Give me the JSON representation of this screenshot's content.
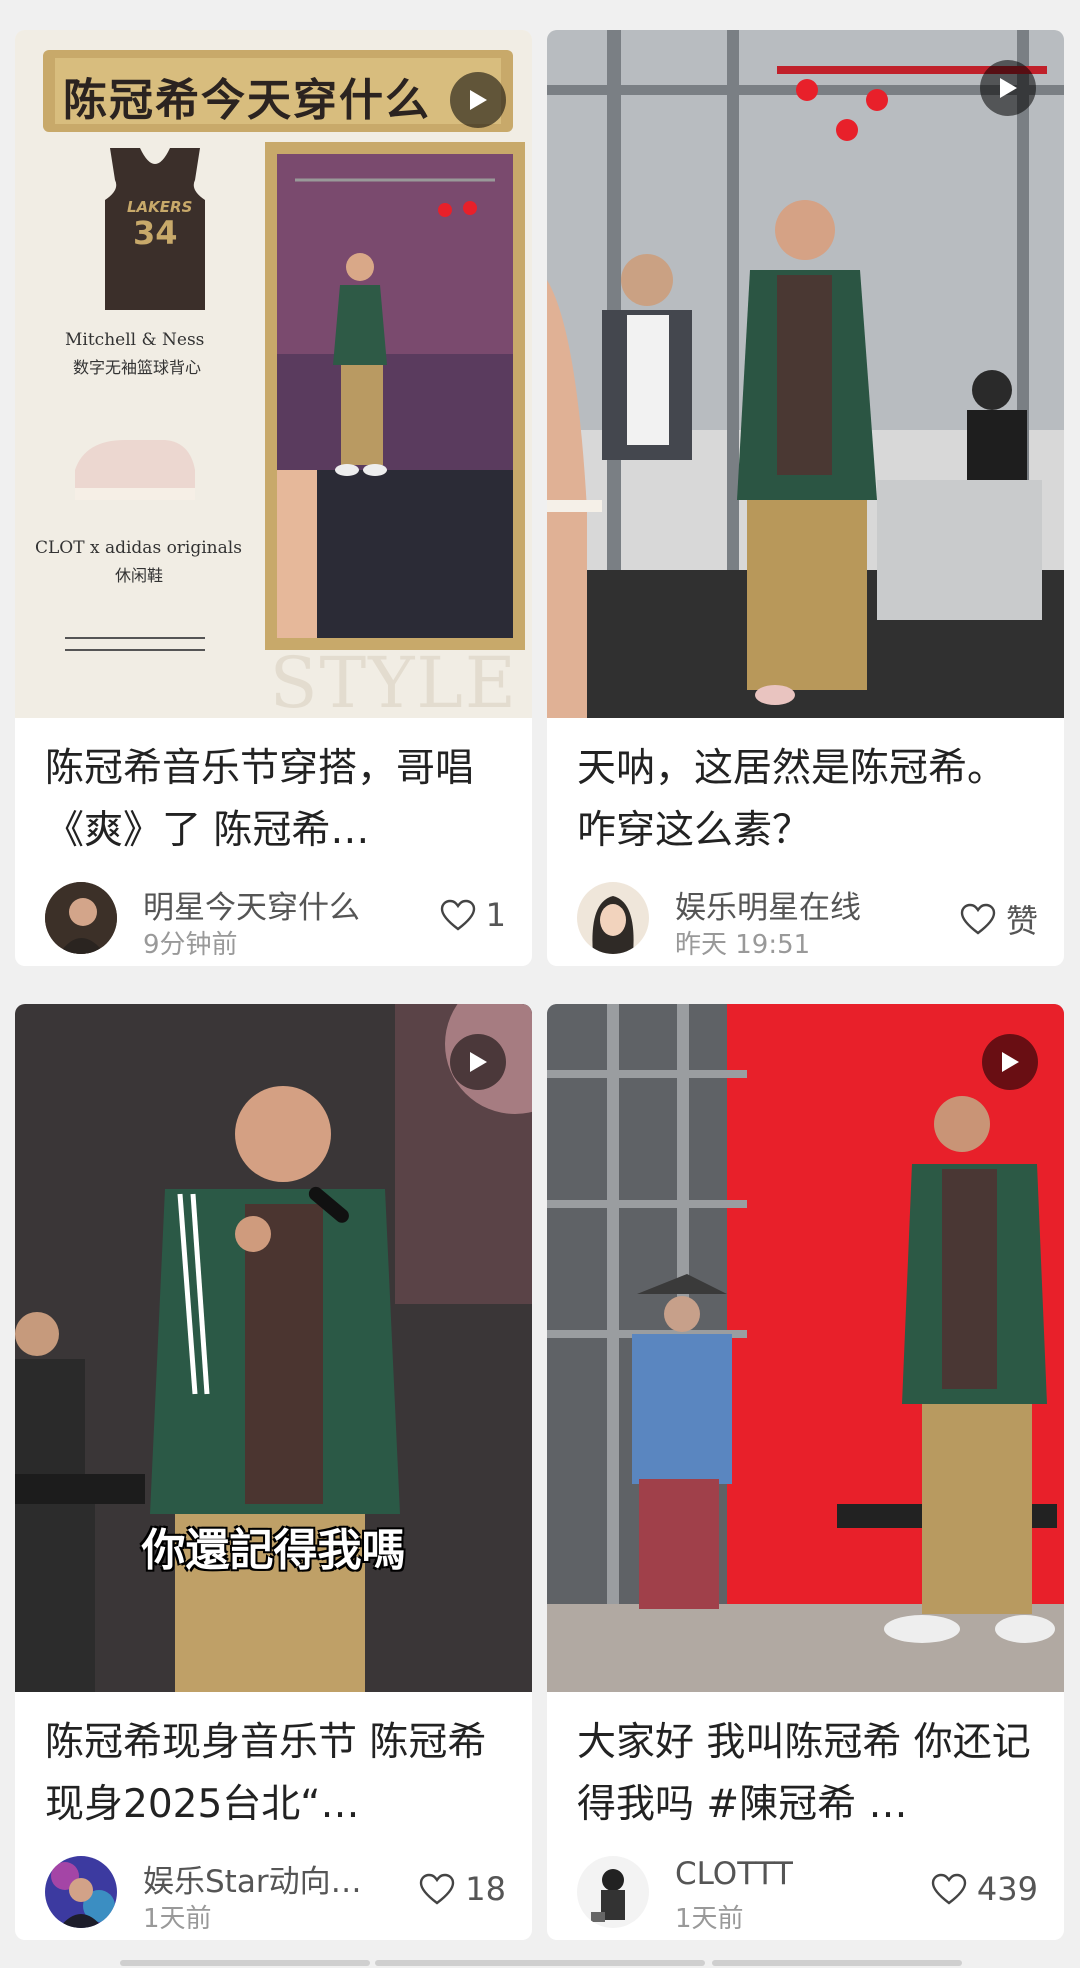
{
  "feed": {
    "cards": [
      {
        "has_play": true,
        "poster": {
          "title": "陈冠希今天穿什么",
          "item1_brand": "Mitchell & Ness",
          "item1_desc": "数字无袖篮球背心",
          "item2_brand": "CLOT x adidas originals",
          "item2_desc": "休闲鞋",
          "watermark": "STYLE",
          "jersey_team": "LAKERS",
          "jersey_number": "34"
        },
        "caption": "陈冠希音乐节穿搭，哥唱《爽》了 陈冠希…",
        "author": "明星今天穿什么",
        "time": "9分钟前",
        "likes": "1"
      },
      {
        "has_play": true,
        "caption": "天呐，这居然是陈冠希。咋穿这么素？",
        "author": "娱乐明星在线",
        "time": "昨天 19:51",
        "likes": "赞"
      },
      {
        "has_play": true,
        "subtitle": "你還記得我嗎",
        "caption": "陈冠希现身音乐节 陈冠希现身2025台北“…",
        "author": "娱乐Star动向…",
        "time": "1天前",
        "likes": "18"
      },
      {
        "has_play": true,
        "caption": "大家好 我叫陈冠希 你还记得我吗 #陳冠希 …",
        "author": "CLOTTT",
        "time": "1天前",
        "likes": "439"
      }
    ]
  },
  "icons": {
    "play": "play-icon",
    "like": "heart-outline-icon"
  },
  "colors": {
    "page_bg": "#f0f0f0",
    "card_bg": "#ffffff",
    "text_primary": "#222222",
    "text_secondary": "#555555",
    "text_tertiary": "#999999",
    "stage_red": "#e8202a",
    "poster_bg": "#f1ede4",
    "poster_gold": "#c8a96a"
  }
}
